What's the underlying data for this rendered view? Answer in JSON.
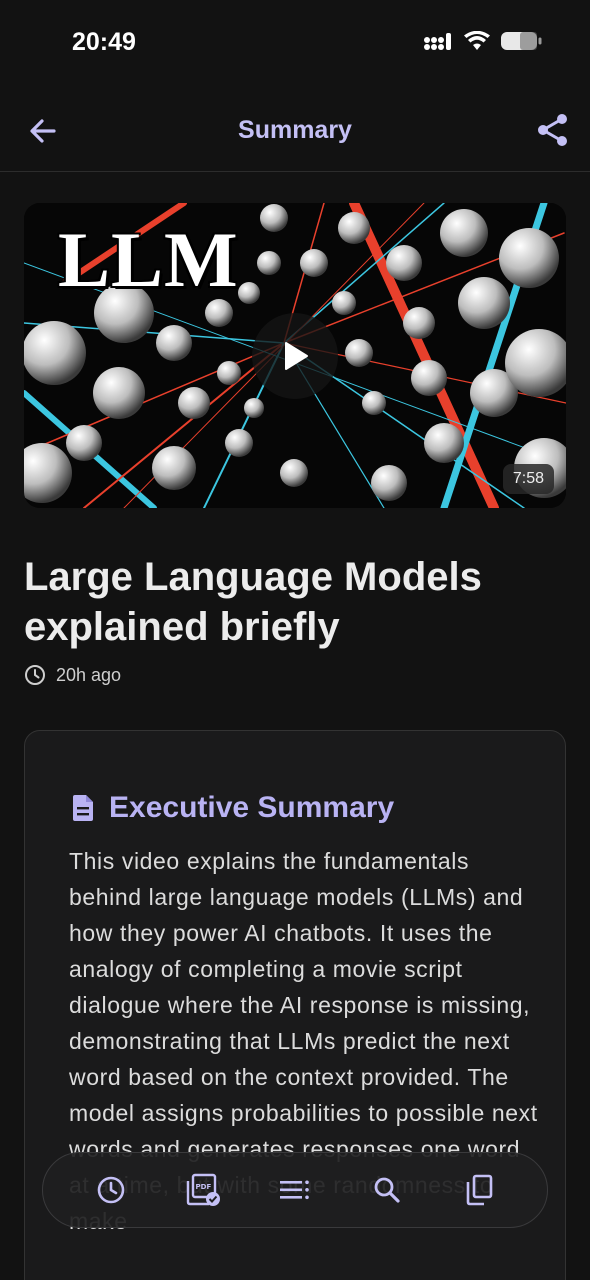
{
  "status": {
    "time": "20:49"
  },
  "header": {
    "title": "Summary"
  },
  "video": {
    "label": "LLM",
    "duration": "7:58"
  },
  "article": {
    "title": "Large Language Models explained briefly",
    "time_ago": "20h ago"
  },
  "summary": {
    "heading": "Executive Summary",
    "body": "This video explains the fundamentals behind large language models (LLMs) and how they power AI chatbots. It uses the analogy of completing a movie script dialogue where the AI response is missing, demonstrating that LLMs predict the next word based on the context provided. The model assigns probabilities to possible next words and generates responses one word at a time, but with some randomness to make"
  },
  "toolbar": {
    "icons": [
      "history-icon",
      "pdf-export-icon",
      "chapters-list-icon",
      "search-icon",
      "copy-icon"
    ]
  },
  "colors": {
    "accent": "#c4c0f5",
    "background": "#121212",
    "card": "#1a1a1b"
  }
}
